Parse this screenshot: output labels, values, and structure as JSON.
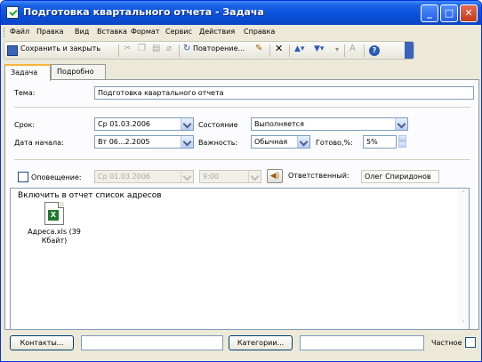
{
  "window": {
    "title": "Подготовка квартального отчета - Задача"
  },
  "menu": [
    "Файл",
    "Правка",
    "Вид",
    "Вставка",
    "Формат",
    "Сервис",
    "Действия",
    "Справка"
  ],
  "toolbar": {
    "save_close": "Сохранить и закрыть",
    "recurrence": "Повторение...",
    "help": "?"
  },
  "tabs": [
    "Задача",
    "Подробно"
  ],
  "task": {
    "subject_label": "Тема:",
    "subject": "Подготовка квартального отчета",
    "due_label": "Срок:",
    "due": "Ср 01.03.2006",
    "start_label": "Дата начала:",
    "start": "Вт 06...2.2005",
    "status_label": "Состояние",
    "status": "Выполняется",
    "priority_label": "Важность:",
    "priority": "Обычная",
    "complete_label": "Готово,%:",
    "complete": "5%",
    "reminder_label": "Оповещение:",
    "reminder_date": "Ср 01.03.2006",
    "reminder_time": "9:00",
    "owner_label": "Ответственный:",
    "owner": "Олег Спиридонов",
    "notes": "Включить в отчет список адресов",
    "attachment": "Адреса.xls (39 Кбайт)"
  },
  "bottom": {
    "contacts": "Контакты...",
    "categories": "Категории...",
    "private": "Частное"
  }
}
